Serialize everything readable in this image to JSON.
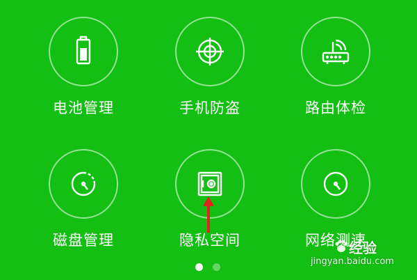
{
  "theme": {
    "background": "#13bf13",
    "foreground": "#ffffff",
    "arrow_color": "#e0241c"
  },
  "tiles": [
    {
      "label": "电池管理",
      "icon": "battery-icon"
    },
    {
      "label": "手机防盗",
      "icon": "crosshair-icon"
    },
    {
      "label": "路由体检",
      "icon": "router-icon"
    },
    {
      "label": "磁盘管理",
      "icon": "disk-gauge-icon"
    },
    {
      "label": "隐私空间",
      "icon": "safe-icon"
    },
    {
      "label": "网络测速",
      "icon": "speedometer-icon"
    }
  ],
  "pager": {
    "pages": 2,
    "active_index": 0
  },
  "watermark": {
    "logo_text": "经验",
    "url": "jingyan.baidu.com"
  }
}
